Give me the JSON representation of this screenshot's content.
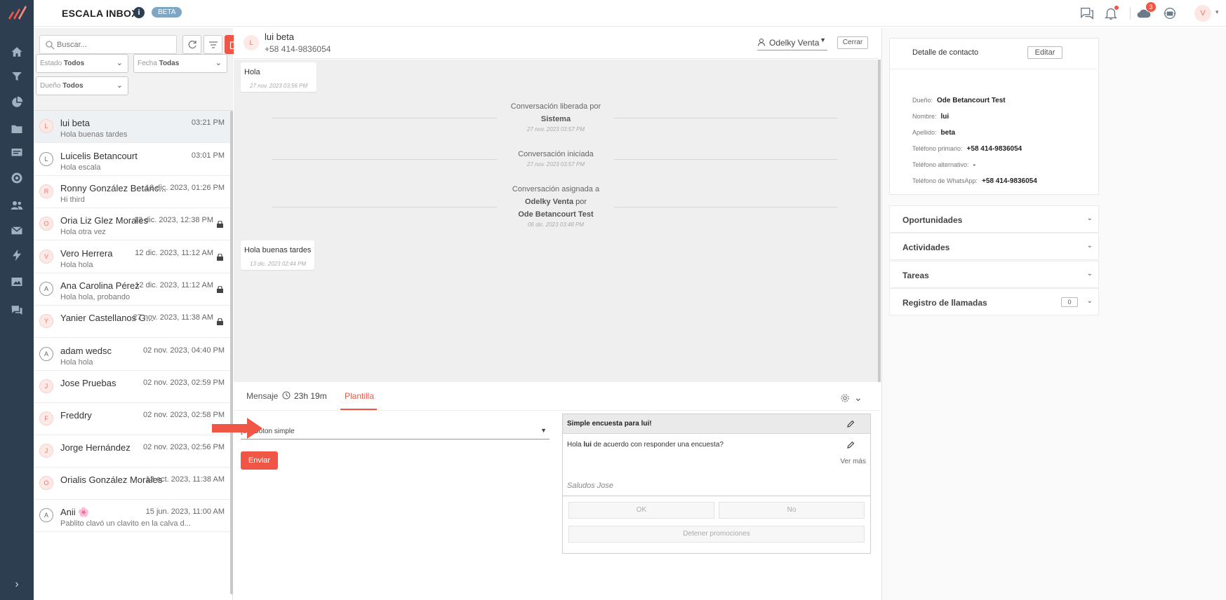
{
  "app": {
    "title": "ESCALA INBOX",
    "beta": "BETA",
    "info": "i",
    "user_initial": "V",
    "notifications_count": "3"
  },
  "filters": {
    "search_placeholder": "Buscar...",
    "estado_label": "Estado",
    "estado_value": "Todos",
    "fecha_label": "Fecha",
    "fecha_value": "Todas",
    "dueno_label": "Dueño",
    "dueno_value": "Todos"
  },
  "conversations": [
    {
      "initial": "L",
      "name": "lui beta",
      "time": "03:21 PM",
      "preview": "Hola buenas tardes"
    },
    {
      "initial": "L",
      "name": "Luicelis Betancourt",
      "time": "03:01 PM",
      "preview": "Hola escala"
    },
    {
      "initial": "R",
      "name": "Ronny González Betanc...",
      "time": "12 dic. 2023, 01:26 PM",
      "preview": "Hi third"
    },
    {
      "initial": "O",
      "name": "Oria Liz Glez Morales",
      "time": "12 dic. 2023, 12:38 PM",
      "preview": "Hola otra vez"
    },
    {
      "initial": "V",
      "name": "Vero Herrera",
      "time": "12 dic. 2023, 11:12 AM",
      "preview": "Hola hola"
    },
    {
      "initial": "A",
      "name": "Ana Carolina Pérez",
      "time": "12 dic. 2023, 11:12 AM",
      "preview": "Hola hola, probando"
    },
    {
      "initial": "Y",
      "name": "Yanier Castellanos G...",
      "time": "27 nov. 2023, 11:38 AM",
      "preview": ""
    },
    {
      "initial": "A",
      "name": "adam wedsc",
      "time": "02 nov. 2023, 04:40 PM",
      "preview": "Hola hola"
    },
    {
      "initial": "J",
      "name": "Jose Pruebas",
      "time": "02 nov. 2023, 02:59 PM",
      "preview": ""
    },
    {
      "initial": "F",
      "name": "Freddry",
      "time": "02 nov. 2023, 02:58 PM",
      "preview": ""
    },
    {
      "initial": "J",
      "name": "Jorge Hernández",
      "time": "02 nov. 2023, 02:56 PM",
      "preview": ""
    },
    {
      "initial": "O",
      "name": "Orialis González Morales",
      "time": "13 oct. 2023, 11:38 AM",
      "preview": ""
    },
    {
      "initial": "A",
      "name": "Anii 🌸",
      "time": "15 jun. 2023, 11:00 AM",
      "preview": "Pablito clavó un clavito en la calva d..."
    }
  ],
  "chat": {
    "contact_initial": "L",
    "contact_name": "lui beta",
    "contact_phone": "+58 414-9836054",
    "owner": "Odelky Venta",
    "close_label": "Cerrar",
    "messages": [
      {
        "text": "Hola",
        "time": "27 nov. 2023 03:56 PM"
      },
      {
        "text": "Hola buenas tardes",
        "time": "13 dic. 2023 02:44 PM"
      }
    ],
    "system": [
      {
        "line1": "Conversación liberada por",
        "bold": "Sistema",
        "time": "27 nov. 2023 03:57 PM"
      },
      {
        "line1": "Conversación iniciada",
        "time": "27 nov. 2023 03:57 PM"
      },
      {
        "line1": "Conversación asignada a",
        "bold_a": "Odelky Venta",
        "mid": "por",
        "bold": "Ode Betancourt Test",
        "time": "06 dic. 2023 03:48 PM"
      }
    ]
  },
  "composer": {
    "tab_message": "Mensaje",
    "timer": "23h 19m",
    "tab_template": "Plantilla",
    "template_selected": "[es] Boton simple",
    "send_label": "Enviar",
    "preview": {
      "title_prefix": "Simple encuesta para ",
      "title_name": "lui",
      "title_suffix": "!",
      "body_prefix": "Hola ",
      "body_name": "lui",
      "body_suffix": " de acuerdo con responder una encuesta?",
      "see_more": "Ver más",
      "footer": "Saludos Jose",
      "btn_ok": "OK",
      "btn_no": "No",
      "btn_stop": "Detener promociones"
    }
  },
  "contact": {
    "title": "Detalle de contacto",
    "edit_label": "Editar",
    "fields": [
      {
        "label": "Dueño:",
        "value": "Ode Betancourt Test"
      },
      {
        "label": "Nombre:",
        "value": "lui"
      },
      {
        "label": "Apellido:",
        "value": "beta"
      },
      {
        "label": "Teléfono primario:",
        "value": "+58 414-9836054"
      },
      {
        "label": "Teléfono alternativo:",
        "value": "-"
      },
      {
        "label": "Teléfono de WhatsApp:",
        "value": "+58 414-9836054"
      }
    ],
    "sections": [
      {
        "label": "Oportunidades"
      },
      {
        "label": "Actividades"
      },
      {
        "label": "Tareas"
      },
      {
        "label": "Registro de llamadas",
        "count": "0"
      }
    ]
  },
  "colors": {
    "accent": "#f05545",
    "sidebar": "#2c3e50",
    "beta_badge": "#7fa7c4"
  }
}
